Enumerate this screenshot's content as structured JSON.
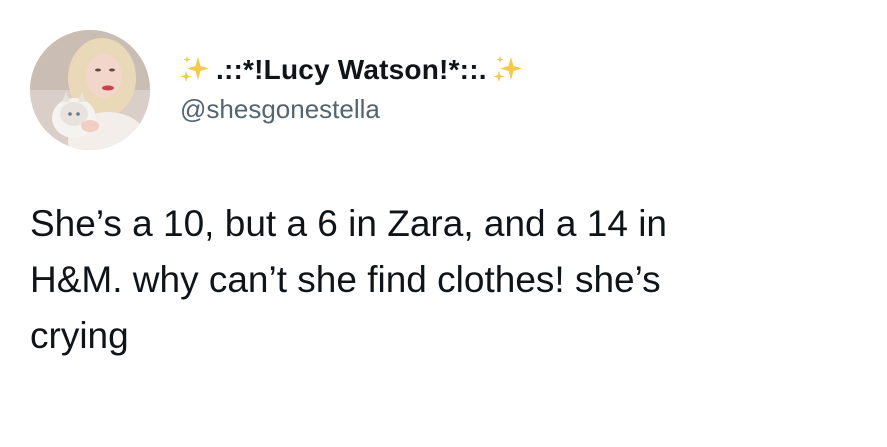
{
  "tweet": {
    "author": {
      "display_name": ".::*!Lucy Watson!*::.",
      "handle": "@shesgonestella",
      "avatar_icon": "profile-photo-avatar",
      "name_decoration_icon": "sparkles-icon"
    },
    "text": "She’s a 10, but a 6 in Zara, and a 14 in\nH&M. why can’t she find clothes! she’s\ncrying"
  },
  "colors": {
    "text": "#0f1419",
    "handle": "#536471",
    "sparkle": "#f4b400",
    "background": "#ffffff"
  }
}
